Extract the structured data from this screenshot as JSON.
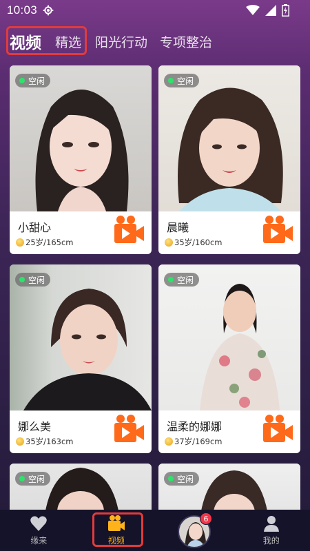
{
  "status_bar": {
    "time": "10:03"
  },
  "tabs": [
    {
      "label": "视频",
      "active": true
    },
    {
      "label": "精选",
      "active": false
    },
    {
      "label": "阳光行动",
      "active": false
    },
    {
      "label": "专项整治",
      "active": false
    }
  ],
  "cards": [
    {
      "status": "空闲",
      "name": "小甜心",
      "meta": "25岁/165cm"
    },
    {
      "status": "空闲",
      "name": "晨曦",
      "meta": "35岁/160cm"
    },
    {
      "status": "空闲",
      "name": "娜么美",
      "meta": "35岁/163cm"
    },
    {
      "status": "空闲",
      "name": "温柔的娜娜",
      "meta": "37岁/169cm"
    },
    {
      "status": "空闲"
    },
    {
      "status": "空闲"
    }
  ],
  "bottom_nav": {
    "items": [
      {
        "label": "缘来",
        "icon": "heart-icon"
      },
      {
        "label": "视频",
        "icon": "video-camera-icon",
        "active": true
      },
      {
        "label": "",
        "icon": "avatar",
        "badge": "6"
      },
      {
        "label": "我的",
        "icon": "user-icon"
      }
    ]
  },
  "colors": {
    "accent": "#ffb21a",
    "video_icon": "#ff6a1a",
    "highlight": "#e23b3b",
    "online": "#2ee36b"
  }
}
